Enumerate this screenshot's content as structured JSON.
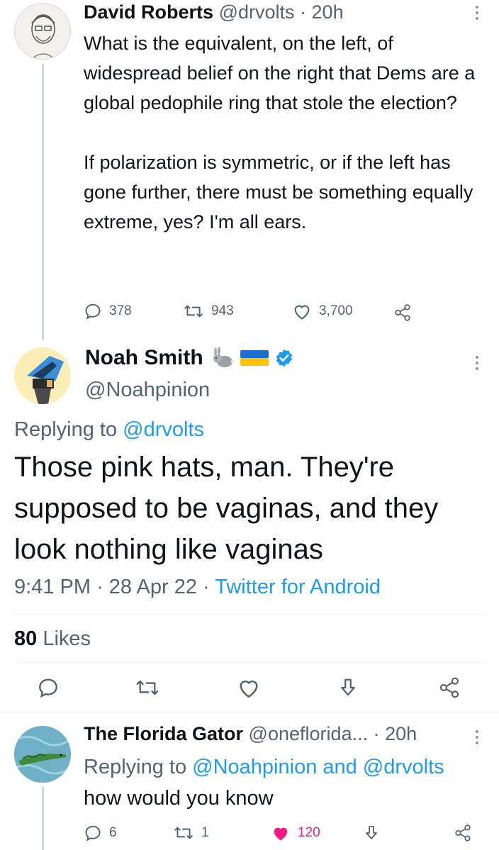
{
  "tweet_1": {
    "author_name": "David Roberts",
    "handle": "@drvolts",
    "separator": "·",
    "time": "20h",
    "text": "What is the equivalent, on the left, of widespread belief on the right that Dems are a global pedophile ring that stole the election?\n\nIf polarization is symmetric, or if the left has gone further, there must be something equally extreme, yes? I'm all ears.",
    "replies": "378",
    "retweets": "943",
    "likes": "3,700"
  },
  "tweet_2": {
    "author_name": "Noah Smith",
    "handle": "@Noahpinion",
    "replying_prefix": "Replying to",
    "replying_to": "@drvolts",
    "text": "Those pink hats, man. They're supposed to be vaginas, and they look nothing like vaginas",
    "time": "9:41 PM",
    "date": "28 Apr 22",
    "separator": "·",
    "source": "Twitter for Android",
    "likes_count": "80",
    "likes_label": "Likes"
  },
  "tweet_3": {
    "author_name": "The Florida Gator",
    "handle": "@oneflorida...",
    "separator": "·",
    "time": "20h",
    "replying_prefix": "Replying to",
    "replying_to": "@Noahpinion and @drvolts",
    "text": "how would you know",
    "replies": "6",
    "retweets": "1",
    "likes": "120"
  },
  "colors": {
    "accent": "#1d9bf0",
    "muted": "#536471",
    "like_active": "#f91880",
    "verified": "#1d9bf0"
  },
  "icons": [
    "reply-icon",
    "retweet-icon",
    "like-icon",
    "share-icon",
    "bookmark-icon",
    "more-icon",
    "verified-icon",
    "rabbit-emoji",
    "ukraine-flag-emoji"
  ]
}
